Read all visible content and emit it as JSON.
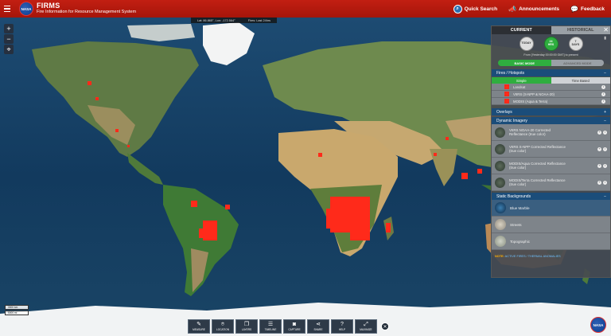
{
  "header": {
    "nasa_label": "NASA",
    "title": "FIRMS",
    "subtitle": "Fire Information for Resource Management System",
    "quick_search": "Quick Search",
    "announcements": "Announcements",
    "feedback": "Feedback"
  },
  "status": {
    "coords": "Lat: 86.865°, Lon: -172.564°",
    "fires": "Fires: Last 24hrs"
  },
  "zoom": {
    "in": "+",
    "out": "−",
    "locate": "⌖"
  },
  "scale": {
    "top": "3000 km",
    "bottom": "5000 mi"
  },
  "toolbar": [
    {
      "label": "MEASURE",
      "icon": "ruler-icon",
      "glyph": "✎"
    },
    {
      "label": "LOCATION",
      "icon": "map-pin-icon",
      "glyph": "⌾"
    },
    {
      "label": "LAYERS",
      "icon": "layers-icon",
      "glyph": "❐"
    },
    {
      "label": "TIMELINE",
      "icon": "sliders-icon",
      "glyph": "☰"
    },
    {
      "label": "CAPTURE",
      "icon": "camera-icon",
      "glyph": "◙"
    },
    {
      "label": "SHARE",
      "icon": "share-icon",
      "glyph": "⋖"
    },
    {
      "label": "HELP",
      "icon": "help-icon",
      "glyph": "?"
    },
    {
      "label": "MAXIMIZE",
      "icon": "expand-icon",
      "glyph": "⤢"
    }
  ],
  "toolbar_close": "✕",
  "nasa_bottom": "NASA",
  "panel": {
    "tab_current": "CURRENT",
    "tab_historical": "HISTORICAL",
    "close": "✕",
    "ranges": [
      {
        "l1": "TODAY",
        "l2": ""
      },
      {
        "l1": "24",
        "l2": "HRS"
      },
      {
        "l1": "7",
        "l2": "DAYS"
      }
    ],
    "from_text": "From [Yesterday 00:00:00 GMT] to present",
    "mode_basic": "BASIC MODE",
    "mode_advanced": "ADVANCED MODE",
    "fires_title": "Fires / Hotspots",
    "fires_simple": "Simple",
    "fires_time": "Time Based",
    "fire_layers": [
      "Landsat",
      "VIIRS (S-NPP & NOAA-20)",
      "MODIS (Aqua & Terra)"
    ],
    "overlays_title": "Overlays",
    "imagery_title": "Dynamic Imagery",
    "imagery": [
      {
        "l1": "VIIRS NOAA-20 Corrected",
        "l2": "Reflectance (true color)"
      },
      {
        "l1": "VIIRS S-NPP Corrected Reflectance",
        "l2": "(true color)"
      },
      {
        "l1": "MODIS/Aqua Corrected Reflectance",
        "l2": "(true color)"
      },
      {
        "l1": "MODIS/Terra Corrected Reflectance",
        "l2": "(true color)"
      }
    ],
    "backgrounds_title": "Static Backgrounds",
    "backgrounds": [
      "Blue Marble",
      "Streets",
      "Topographic"
    ],
    "note_label": "NOTE:",
    "note_text": "ACTIVE FIRES / THERMAL ANOMALIES"
  },
  "colors": {
    "header": "#b81a0e",
    "fire": "#ff2a1a",
    "ocean": "#143a5c",
    "active": "#2fae3f"
  }
}
